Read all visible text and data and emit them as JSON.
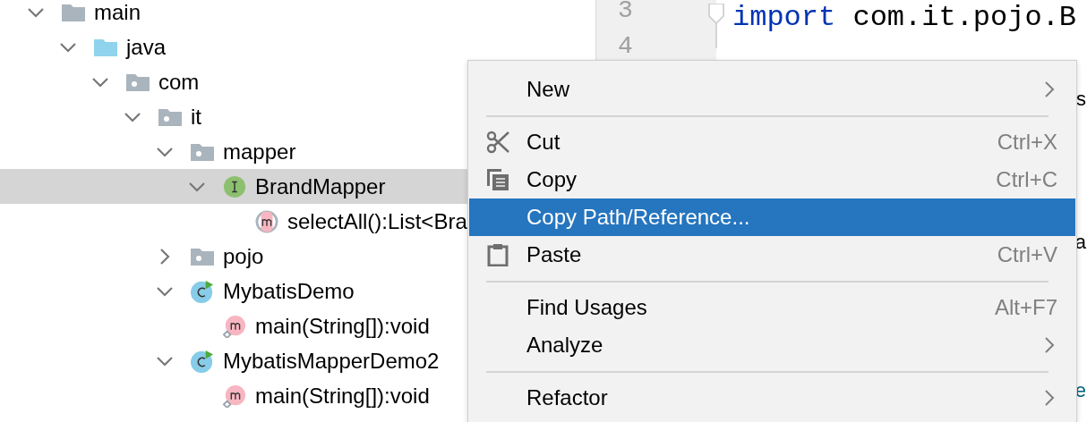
{
  "project_tree": {
    "nodes": [
      {
        "label": "main",
        "kind": "folder",
        "expanded": true,
        "selected": false,
        "children": [
          {
            "label": "java",
            "kind": "source-folder",
            "expanded": true,
            "selected": false,
            "children": [
              {
                "label": "com",
                "kind": "package",
                "expanded": true,
                "selected": false,
                "children": [
                  {
                    "label": "it",
                    "kind": "package",
                    "expanded": true,
                    "selected": false,
                    "children": [
                      {
                        "label": "mapper",
                        "kind": "package",
                        "expanded": true,
                        "selected": false,
                        "children": [
                          {
                            "label": "BrandMapper",
                            "kind": "interface",
                            "expanded": true,
                            "selected": true,
                            "children": [
                              {
                                "label": "selectAll():List<Bra",
                                "kind": "abstract-method",
                                "selected": false
                              }
                            ]
                          }
                        ]
                      },
                      {
                        "label": "pojo",
                        "kind": "package",
                        "expanded": false,
                        "selected": false
                      },
                      {
                        "label": "MybatisDemo",
                        "kind": "class",
                        "expanded": true,
                        "selected": false,
                        "children": [
                          {
                            "label": "main(String[]):void",
                            "kind": "static-method",
                            "selected": false
                          }
                        ]
                      },
                      {
                        "label": "MybatisMapperDemo2",
                        "kind": "class",
                        "expanded": true,
                        "selected": false,
                        "children": [
                          {
                            "label": "main(String[]):void",
                            "kind": "static-method",
                            "selected": false
                          }
                        ]
                      }
                    ]
                  }
                ]
              }
            ]
          }
        ]
      }
    ]
  },
  "editor": {
    "line_numbers": [
      "3",
      "4"
    ],
    "code_lines": [
      {
        "kind": "import",
        "keyword": "import",
        "text": "com.it.pojo.B"
      },
      {
        "kind": "fragment",
        "text": "s",
        "color": "#000000"
      },
      {
        "kind": "fragment",
        "text": "a",
        "color": "#000000"
      },
      {
        "kind": "fragment",
        "text": "e",
        "color": "#00627a"
      }
    ]
  },
  "context_menu": {
    "items": [
      {
        "kind": "submenu",
        "label": "New",
        "selected": false
      },
      {
        "kind": "separator"
      },
      {
        "kind": "cut",
        "label": "Cut",
        "shortcut": "Ctrl+X",
        "selected": false
      },
      {
        "kind": "copy",
        "label": "Copy",
        "shortcut": "Ctrl+C",
        "selected": false
      },
      {
        "kind": "command",
        "label": "Copy Path/Reference...",
        "selected": true
      },
      {
        "kind": "paste",
        "label": "Paste",
        "shortcut": "Ctrl+V",
        "selected": false
      },
      {
        "kind": "separator"
      },
      {
        "kind": "command",
        "label": "Find Usages",
        "shortcut": "Alt+F7",
        "selected": false
      },
      {
        "kind": "submenu",
        "label": "Analyze",
        "selected": false
      },
      {
        "kind": "separator"
      },
      {
        "kind": "submenu",
        "label": "Refactor",
        "selected": false
      }
    ]
  }
}
